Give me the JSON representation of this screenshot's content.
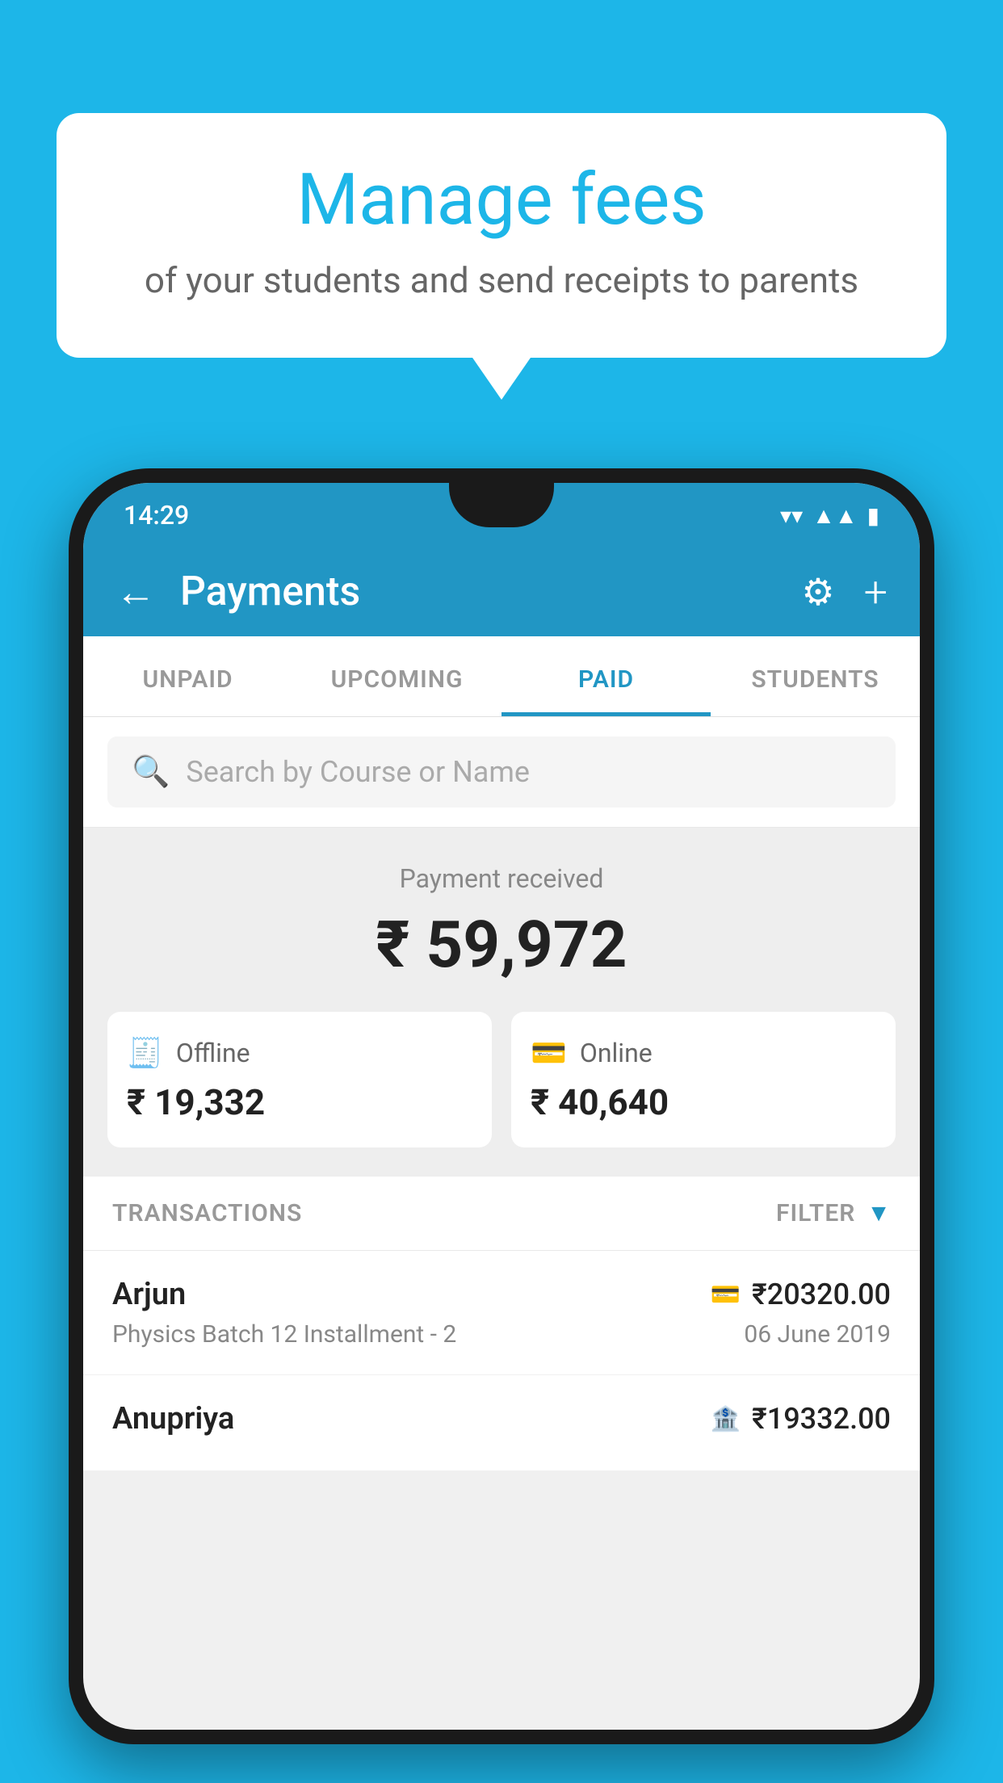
{
  "background_color": "#1db6e8",
  "bubble": {
    "title": "Manage fees",
    "subtitle": "of your students and send receipts to parents"
  },
  "phone": {
    "status_bar": {
      "time": "14:29"
    },
    "header": {
      "title": "Payments",
      "back_label": "←",
      "gear_label": "⚙",
      "plus_label": "+"
    },
    "tabs": [
      {
        "label": "UNPAID",
        "active": false
      },
      {
        "label": "UPCOMING",
        "active": false
      },
      {
        "label": "PAID",
        "active": true
      },
      {
        "label": "STUDENTS",
        "active": false
      }
    ],
    "search": {
      "placeholder": "Search by Course or Name"
    },
    "payment_summary": {
      "label": "Payment received",
      "amount": "₹ 59,972",
      "offline": {
        "icon": "💳",
        "label": "Offline",
        "amount": "₹ 19,332"
      },
      "online": {
        "icon": "💳",
        "label": "Online",
        "amount": "₹ 40,640"
      }
    },
    "transactions": {
      "section_label": "TRANSACTIONS",
      "filter_label": "FILTER",
      "rows": [
        {
          "name": "Arjun",
          "method_icon": "💳",
          "amount": "₹20320.00",
          "course": "Physics Batch 12 Installment - 2",
          "date": "06 June 2019"
        },
        {
          "name": "Anupriya",
          "method_icon": "🏦",
          "amount": "₹19332.00",
          "course": "",
          "date": ""
        }
      ]
    }
  }
}
